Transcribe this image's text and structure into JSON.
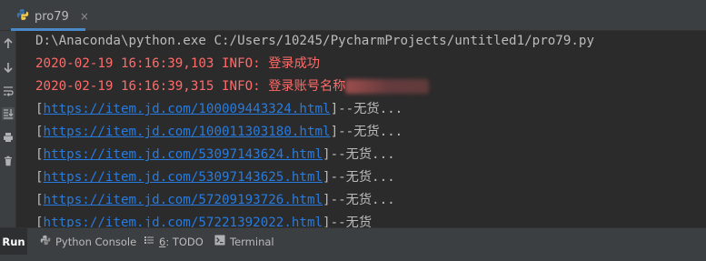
{
  "tab": {
    "title": "pro79",
    "close": "×"
  },
  "console": {
    "command": "D:\\Anaconda\\python.exe C:/Users/10245/PycharmProjects/untitled1/pro79.py",
    "log1": "2020-02-19 16:16:39,103 INFO: 登录成功",
    "log2": "2020-02-19 16:16:39,315 INFO: 登录账号名称",
    "items": [
      {
        "url": "https://item.jd.com/100009443324.html",
        "status": "--无货..."
      },
      {
        "url": "https://item.jd.com/100011303180.html",
        "status": "--无货..."
      },
      {
        "url": "https://item.jd.com/53097143624.html",
        "status": "--无货..."
      },
      {
        "url": "https://item.jd.com/53097143625.html",
        "status": "--无货..."
      },
      {
        "url": "https://item.jd.com/57209193726.html",
        "status": "--无货..."
      },
      {
        "url": "https://item.jd.com/57221392022.html",
        "status": "--无货"
      }
    ]
  },
  "bottom": {
    "run": "Run",
    "python_console": "Python Console",
    "todo_key": "6",
    "todo": ": TODO",
    "terminal": "Terminal"
  }
}
